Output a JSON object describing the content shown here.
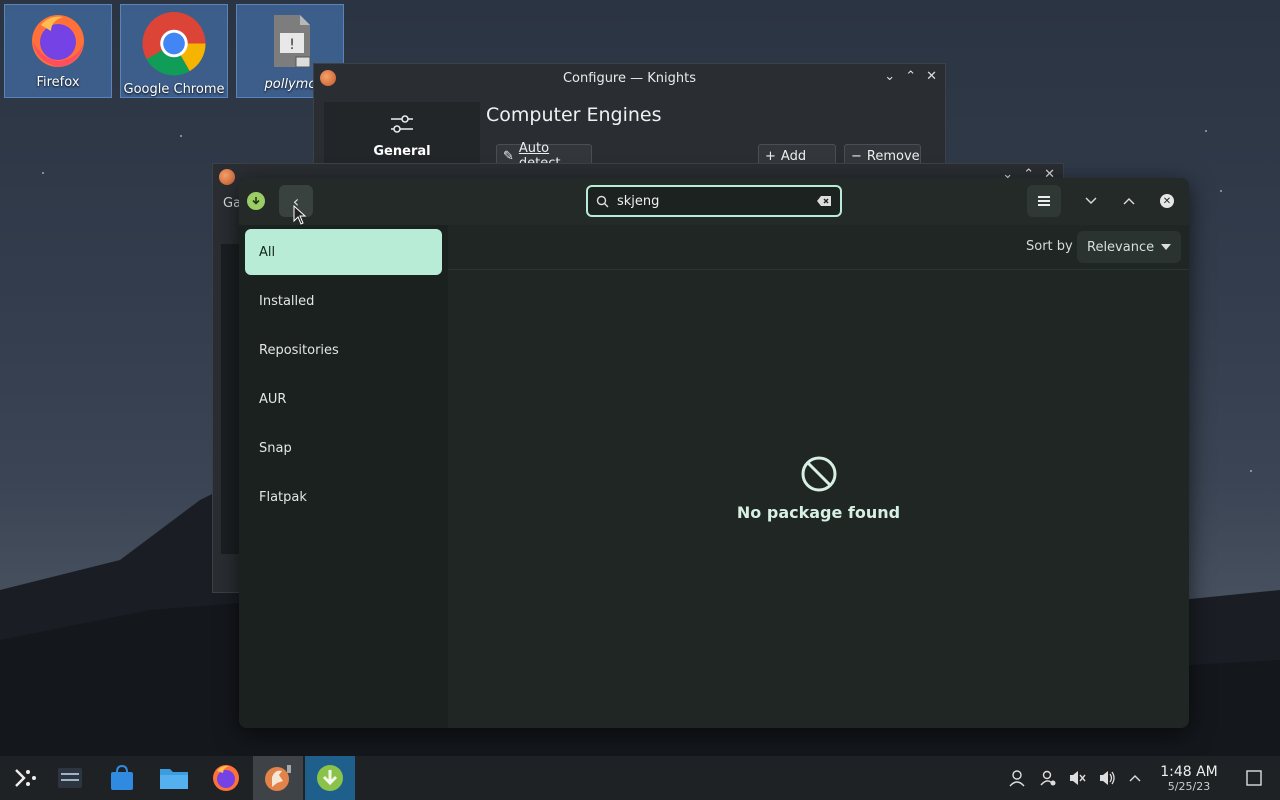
{
  "desktop": {
    "icons": [
      {
        "label": "Firefox",
        "icon": "firefox-icon"
      },
      {
        "label": "Google Chrome",
        "icon": "chrome-icon"
      },
      {
        "label": "pollymc",
        "icon": "script-file-icon"
      }
    ]
  },
  "configure_window": {
    "title": "Configure — Knights",
    "sidebar_label": "General",
    "heading": "Computer Engines",
    "auto_detect": "Auto detect",
    "add": "Add",
    "remove": "Remove"
  },
  "game_window": {
    "menu_label": "Ga"
  },
  "pamac": {
    "search": {
      "value": "skjeng"
    },
    "sidebar": {
      "items": [
        {
          "label": "All",
          "active": true
        },
        {
          "label": "Installed"
        },
        {
          "label": "Repositories"
        },
        {
          "label": "AUR"
        },
        {
          "label": "Snap"
        },
        {
          "label": "Flatpak"
        }
      ]
    },
    "sort_by_label": "Sort by",
    "sort_value": "Relevance",
    "empty_message": "No package found"
  },
  "taskbar": {
    "clock_time": "1:48 AM",
    "clock_date": "5/25/23"
  },
  "colors": {
    "accent": "#b9ecd6",
    "pamac_bg": "#1f2623",
    "taskbar_bg": "#1f2225"
  }
}
